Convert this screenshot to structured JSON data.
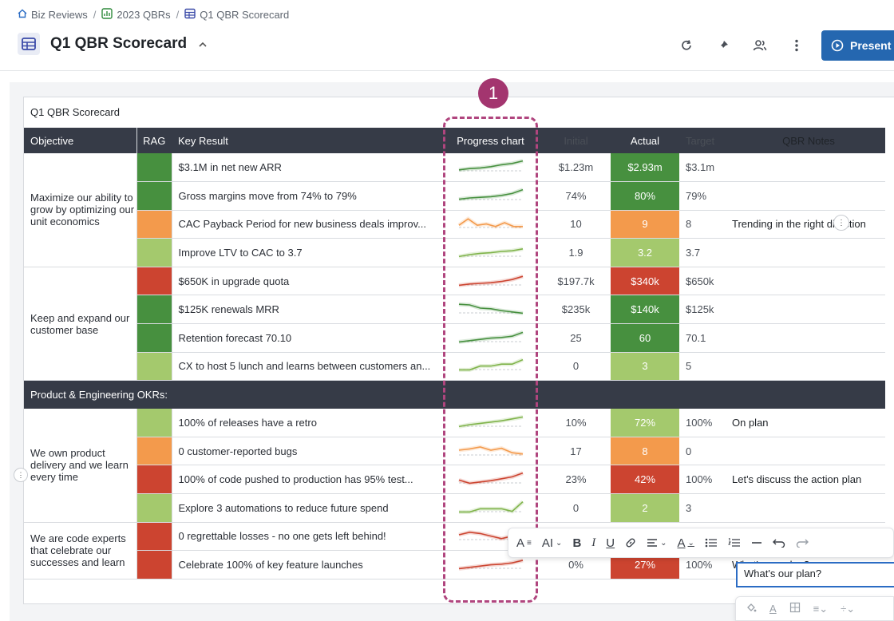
{
  "breadcrumbs": [
    {
      "label": "Biz Reviews",
      "icon": "home-icon"
    },
    {
      "label": "2023 QBRs",
      "icon": "folder-chart-icon"
    },
    {
      "label": "Q1 QBR Scorecard",
      "icon": "table-icon"
    }
  ],
  "page": {
    "title": "Q1 QBR Scorecard",
    "present_label": "Present"
  },
  "sheet": {
    "caption": "Q1 QBR Scorecard",
    "badge": "1"
  },
  "columns": {
    "objective": "Objective",
    "rag": "RAG",
    "key_result": "Key Result",
    "progress": "Progress chart",
    "initial": "Initial",
    "actual": "Actual",
    "target": "Target",
    "notes": "QBR Notes"
  },
  "section_label": "Product & Engineering OKRs:",
  "objectives": [
    "Maximize our ability to grow by optimizing our unit economics",
    "Keep and expand our customer base",
    "We own product delivery and we learn every time",
    "We are code experts that celebrate our successes and learn"
  ],
  "rows": [
    {
      "kr": "$3.1M in net new ARR",
      "initial": "$1.23m",
      "actual": "$2.93m",
      "target": "$3.1m",
      "notes": "",
      "rag": "green",
      "actual_color": "green",
      "spark": [
        0.2,
        0.3,
        0.35,
        0.45,
        0.6,
        0.7,
        0.9
      ]
    },
    {
      "kr": "Gross margins move from 74% to 79%",
      "initial": "74%",
      "actual": "80%",
      "target": "79%",
      "notes": "",
      "rag": "green",
      "actual_color": "green",
      "spark": [
        0.15,
        0.25,
        0.3,
        0.35,
        0.45,
        0.6,
        0.9
      ]
    },
    {
      "kr": "CAC Payback Period for new business deals improv...",
      "initial": "10",
      "actual": "9",
      "target": "8",
      "notes": "Trending in the right direction",
      "rag": "orange",
      "actual_color": "orange",
      "spark": [
        0.3,
        0.8,
        0.3,
        0.4,
        0.2,
        0.5,
        0.2,
        0.2
      ]
    },
    {
      "kr": "Improve LTV to CAC to 3.7",
      "initial": "1.9",
      "actual": "3.2",
      "target": "3.7",
      "notes": "",
      "rag": "lgreen",
      "actual_color": "lgreen",
      "spark": [
        0.1,
        0.25,
        0.35,
        0.4,
        0.5,
        0.55,
        0.7
      ]
    },
    {
      "kr": "$650K in upgrade quota",
      "initial": "$197.7k",
      "actual": "$340k",
      "target": "$650k",
      "notes": "",
      "rag": "red",
      "actual_color": "red",
      "spark": [
        0.1,
        0.2,
        0.25,
        0.3,
        0.4,
        0.55,
        0.8
      ]
    },
    {
      "kr": "$125K renewals MRR",
      "initial": "$235k",
      "actual": "$140k",
      "target": "$125k",
      "notes": "",
      "rag": "green",
      "actual_color": "green",
      "spark": [
        0.8,
        0.75,
        0.5,
        0.45,
        0.3,
        0.2,
        0.1
      ]
    },
    {
      "kr": "Retention forecast 70.10",
      "initial": "25",
      "actual": "60",
      "target": "70.1",
      "notes": "",
      "rag": "green",
      "actual_color": "green",
      "spark": [
        0.1,
        0.2,
        0.3,
        0.4,
        0.45,
        0.55,
        0.85
      ]
    },
    {
      "kr": "CX to host 5 lunch and learns between customers an...",
      "initial": "0",
      "actual": "3",
      "target": "5",
      "notes": "",
      "rag": "lgreen",
      "actual_color": "lgreen",
      "spark": [
        0.1,
        0.1,
        0.4,
        0.4,
        0.55,
        0.55,
        0.9
      ]
    },
    {
      "kr": "100% of releases have a retro",
      "initial": "10%",
      "actual": "72%",
      "target": "100%",
      "notes": "On plan",
      "rag": "lgreen",
      "actual_color": "lgreen",
      "spark": [
        0.1,
        0.25,
        0.35,
        0.45,
        0.55,
        0.7,
        0.85
      ]
    },
    {
      "kr": "0 customer-reported bugs",
      "initial": "17",
      "actual": "8",
      "target": "0",
      "notes": "",
      "rag": "orange",
      "actual_color": "orange",
      "spark": [
        0.5,
        0.6,
        0.75,
        0.5,
        0.65,
        0.3,
        0.2
      ]
    },
    {
      "kr": "100% of code pushed to production has 95% test...",
      "initial": "23%",
      "actual": "42%",
      "target": "100%",
      "notes": "Let's discuss the action plan",
      "rag": "red",
      "actual_color": "red",
      "spark": [
        0.35,
        0.1,
        0.2,
        0.3,
        0.45,
        0.6,
        0.9
      ]
    },
    {
      "kr": "Explore 3 automations to reduce future spend",
      "initial": "0",
      "actual": "2",
      "target": "3",
      "notes": "",
      "rag": "lgreen",
      "actual_color": "lgreen",
      "spark": [
        0.1,
        0.1,
        0.35,
        0.35,
        0.35,
        0.15,
        0.9
      ]
    },
    {
      "kr": "0 regrettable losses - no one gets left behind!",
      "initial": "",
      "actual": "",
      "target": "",
      "notes": "",
      "rag": "red",
      "actual_color": "none",
      "spark": [
        0.5,
        0.7,
        0.6,
        0.4,
        0.2,
        0.4,
        0.1
      ]
    },
    {
      "kr": "Celebrate 100% of key feature launches",
      "initial": "0%",
      "actual": "27%",
      "target": "100%",
      "notes": "What's our plan?",
      "rag": "red",
      "actual_color": "red",
      "spark": [
        0.1,
        0.2,
        0.3,
        0.4,
        0.45,
        0.55,
        0.75
      ]
    }
  ],
  "colors": {
    "green": "#47903f",
    "lgreen": "#a4c96d",
    "orange": "#f39a4c",
    "red": "#cc4430",
    "accent": "#2567b0",
    "highlight": "#b0457e"
  },
  "toolbar_icons": [
    "text-style-icon",
    "font-size-icon",
    "bold-icon",
    "italic-icon",
    "underline-icon",
    "link-icon",
    "align-icon",
    "text-color-icon",
    "bullet-list-icon",
    "numbered-list-icon",
    "divider-icon",
    "undo-icon",
    "redo-icon"
  ]
}
